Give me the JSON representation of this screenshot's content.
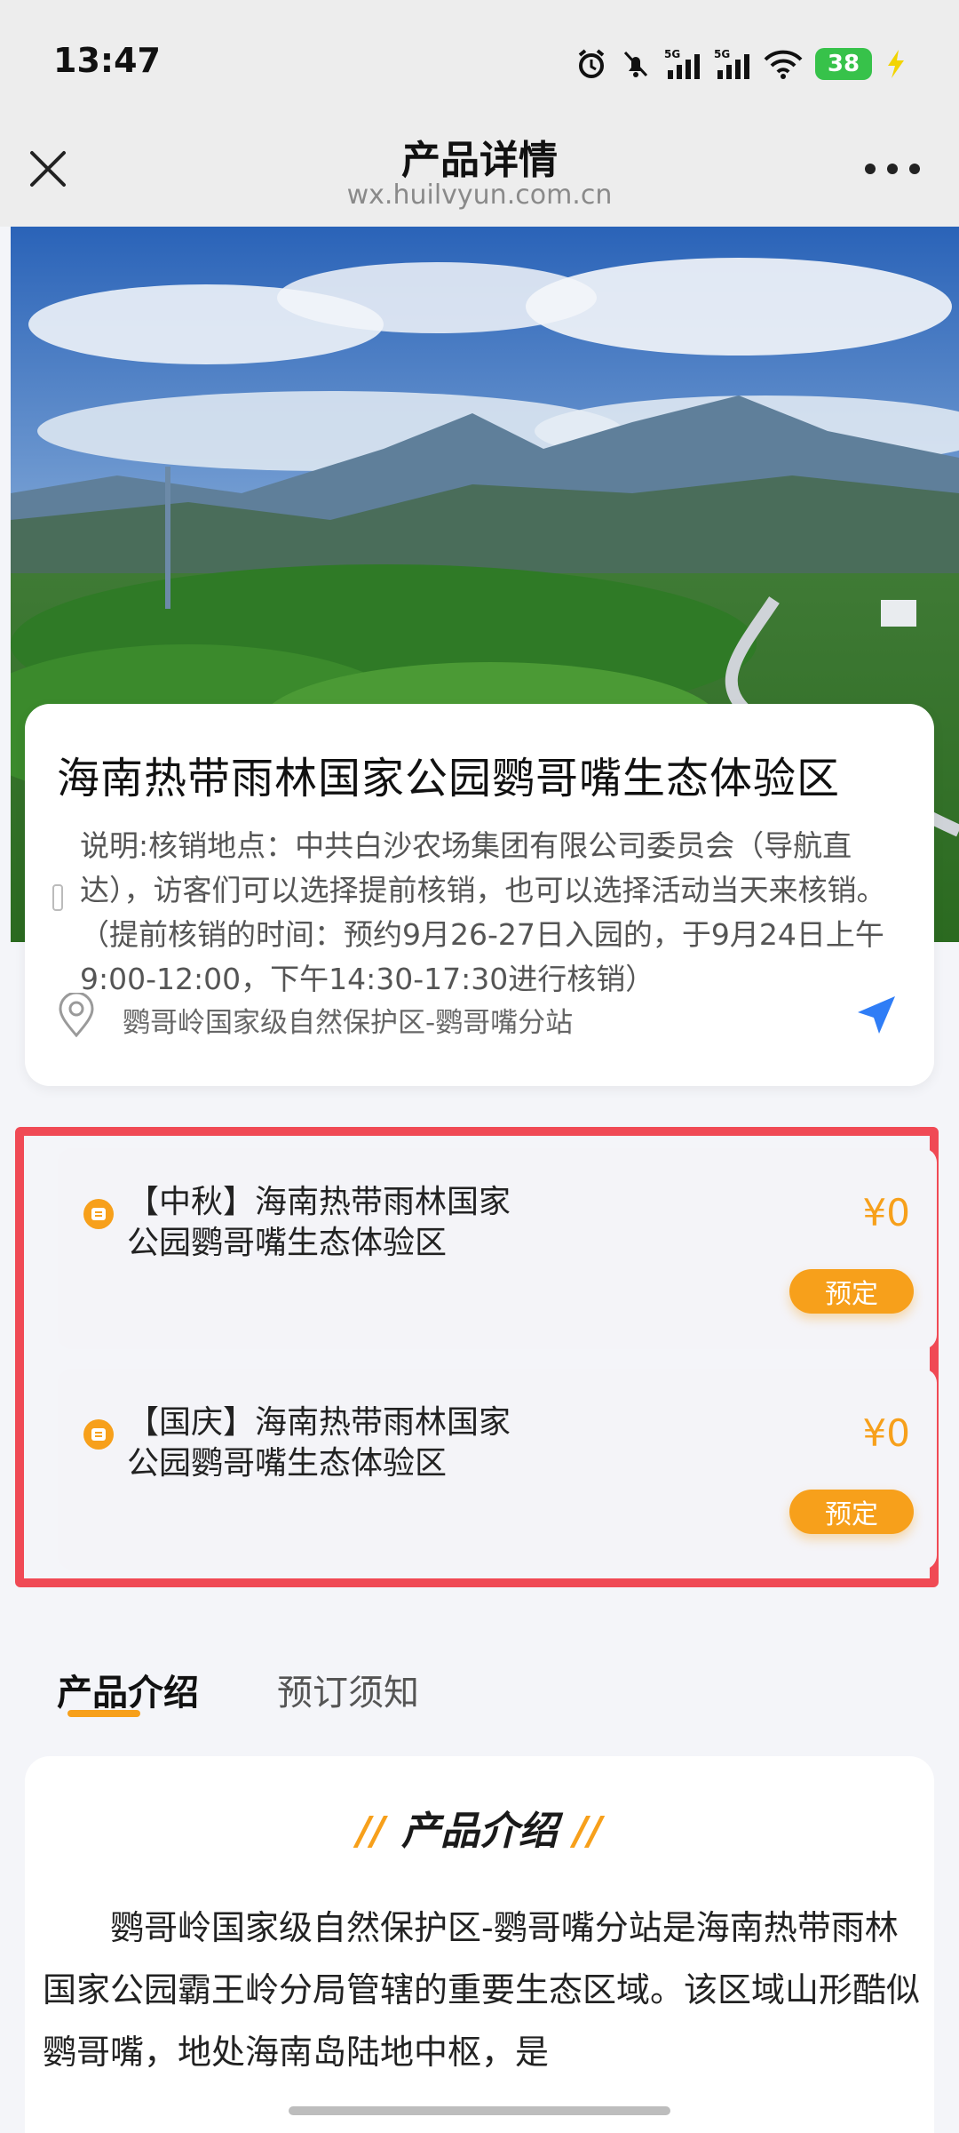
{
  "status_bar": {
    "time": "13:47",
    "battery": "38",
    "icons": [
      "alarm-icon",
      "mute-icon",
      "signal-5g-icon",
      "signal-5g-icon",
      "wifi-icon",
      "battery-icon",
      "charging-icon"
    ]
  },
  "header": {
    "title": "产品详情",
    "url": "wx.huilvyun.com.cn",
    "close_icon": "close-icon",
    "more_icon": "more-icon"
  },
  "product": {
    "title": "海南热带雨林国家公园鹦哥嘴生态体验区",
    "description": "说明:核销地点：中共白沙农场集团有限公司委员会（导航直达），访客们可以选择提前核销，也可以选择活动当天来核销。（提前核销的时间：预约9月26-27日入园的，于9月24日上午9:00-12:00，下午14:30-17:30进行核销）",
    "location": "鹦哥岭国家级自然保护区-鹦哥嘴分站"
  },
  "tickets": [
    {
      "name_line1": "【中秋】海南热带雨林国家",
      "name_line2": "公园鹦哥嘴生态体验区",
      "price": "¥0",
      "button": "预定"
    },
    {
      "name_line1": "【国庆】海南热带雨林国家",
      "name_line2": "公园鹦哥嘴生态体验区",
      "price": "¥0",
      "button": "预定"
    }
  ],
  "tabs": [
    "产品介绍",
    "预订须知"
  ],
  "intro": {
    "heading": "产品介绍",
    "text": "鹦哥岭国家级自然保护区-鹦哥嘴分站是海南热带雨林国家公园霸王岭分局管辖的重要生态区域。该区域山形酷似鹦哥嘴，地处海南岛陆地中枢，是"
  },
  "colors": {
    "accent": "#f7a01b",
    "highlight_border": "#f04a55",
    "nav_blue": "#2f7df6"
  }
}
